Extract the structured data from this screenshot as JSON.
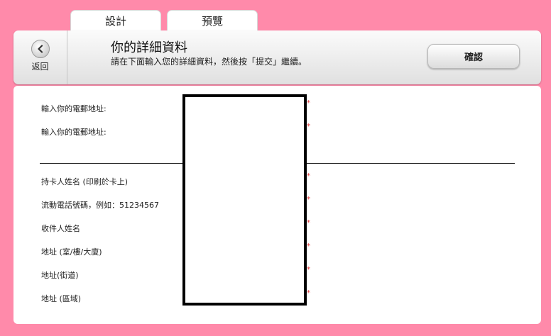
{
  "tabs": [
    {
      "label": "設計"
    },
    {
      "label": "預覽"
    }
  ],
  "header": {
    "back_label": "返回",
    "title": "你的詳細資料",
    "subtitle": "請在下面輸入您的詳細資料，然後按「提交」繼續。",
    "confirm_label": "確認"
  },
  "form": {
    "fields": [
      {
        "label": "輸入你的電郵地址:",
        "required_mark": "*"
      },
      {
        "label": "輸入你的電郵地址:",
        "required_mark": "*"
      },
      {
        "label": "持卡人姓名 (印刷於卡上)",
        "required_mark": "*"
      },
      {
        "label": "流動電話號碼，例如：51234567",
        "required_mark": "*"
      },
      {
        "label": "收件人姓名",
        "required_mark": "*"
      },
      {
        "label": "地址 (室/樓/大廈)",
        "required_mark": "*"
      },
      {
        "label": "地址(街道)",
        "required_mark": "*"
      },
      {
        "label": "地址 (區域)",
        "required_mark": "*"
      }
    ]
  },
  "colors": {
    "background": "#ff8aaa",
    "required": "#e03030",
    "redaction_border": "#000000"
  }
}
